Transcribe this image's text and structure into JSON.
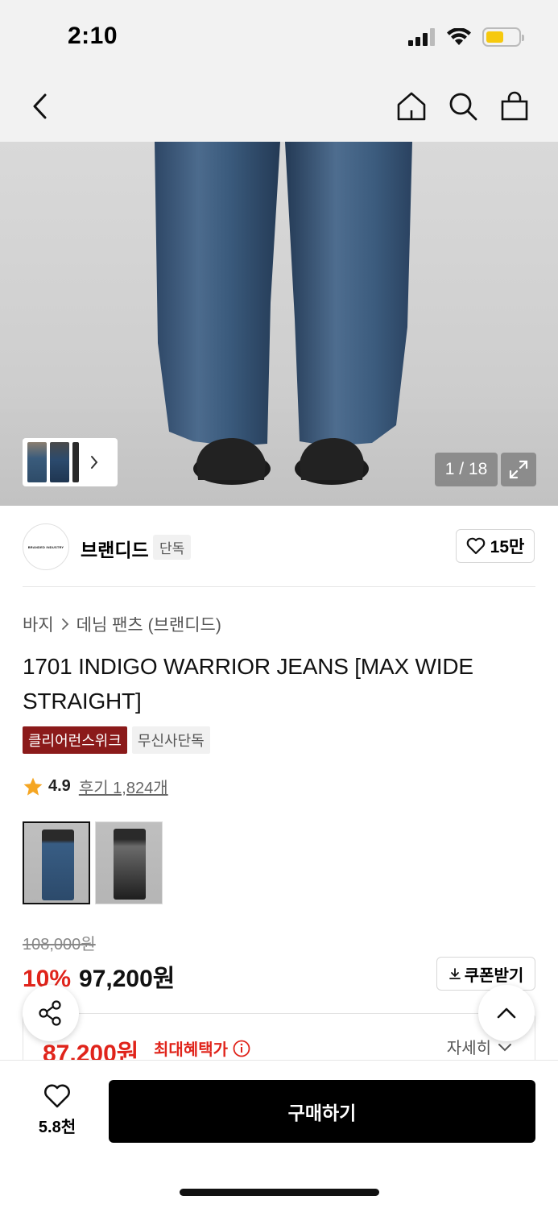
{
  "status_bar": {
    "time": "2:10"
  },
  "gallery": {
    "counter": "1 / 18"
  },
  "brand": {
    "logo_text": "BRANDED INDUSTRY",
    "name": "브랜디드",
    "tag": "단독",
    "favorite_count": "15만"
  },
  "breadcrumb": {
    "category": "바지",
    "subcategory": "데님 팬츠 (브랜디드)"
  },
  "product": {
    "title": "1701 INDIGO WARRIOR JEANS [MAX WIDE STRAIGHT]",
    "tags": [
      "클리어런스위크",
      "무신사단독"
    ],
    "rating": "4.9",
    "review_text": "후기 1,824개",
    "variants": [
      "indigo",
      "black"
    ]
  },
  "price": {
    "original": "108,000원",
    "discount": "10%",
    "sale": "97,200원",
    "coupon_label": "쿠폰받기",
    "max_benefit_price": "87,200원",
    "max_benefit_label": "최대혜택가",
    "detail_label": "자세히"
  },
  "bottom_bar": {
    "like_count": "5.8천",
    "buy_label": "구매하기"
  },
  "colors": {
    "accent_red": "#e0241b",
    "tag_red": "#8b1a1a",
    "buy_button": "#000000"
  }
}
